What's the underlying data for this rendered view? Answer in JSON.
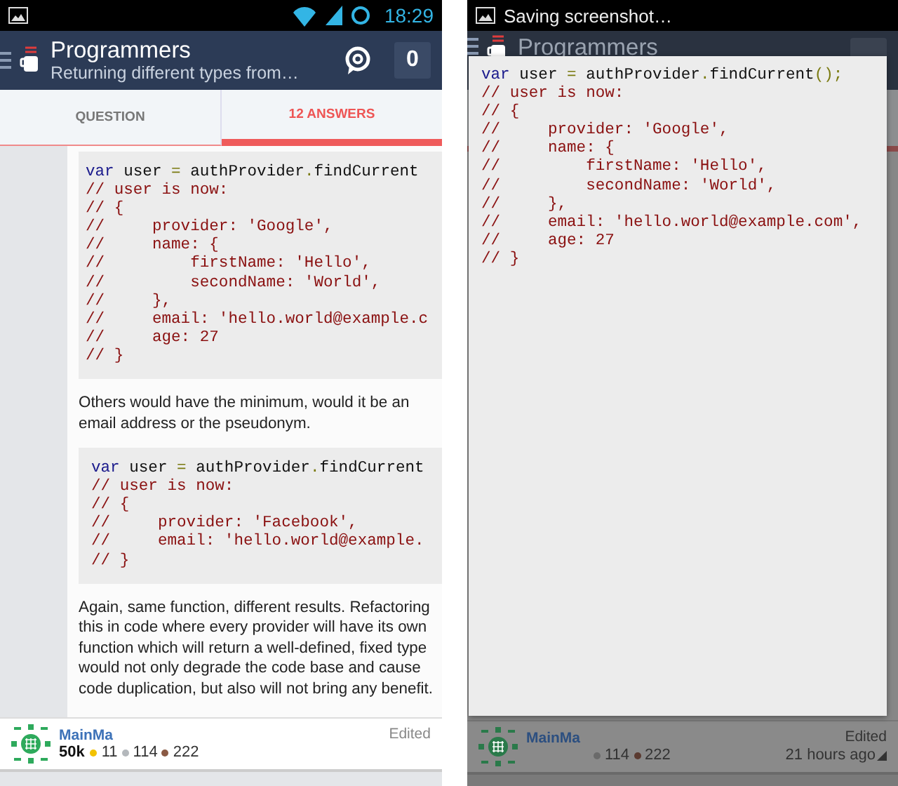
{
  "left_screen": {
    "status_bar": {
      "time": "18:29"
    },
    "header": {
      "title": "Programmers",
      "subtitle": "Returning different types from…",
      "count": "0"
    },
    "tabs": [
      {
        "label": "QUESTION",
        "selected": false
      },
      {
        "label": "12 ANSWERS",
        "selected": true
      }
    ],
    "answer": [
      {
        "kind": "code",
        "lines": [
          [
            {
              "kind": "keyword",
              "text": "var"
            },
            {
              "kind": "plain",
              "text": " user "
            },
            {
              "kind": "punct",
              "text": "="
            },
            {
              "kind": "plain",
              "text": " authProvider"
            },
            {
              "kind": "punct",
              "text": "."
            },
            {
              "kind": "plain",
              "text": "findCurrent"
            }
          ],
          [
            {
              "kind": "comment",
              "text": "// user is now:"
            }
          ],
          [
            {
              "kind": "comment",
              "text": "// {"
            }
          ],
          [
            {
              "kind": "comment",
              "text": "//     provider: 'Google',"
            }
          ],
          [
            {
              "kind": "comment",
              "text": "//     name: {"
            }
          ],
          [
            {
              "kind": "comment",
              "text": "//         firstName: 'Hello',"
            }
          ],
          [
            {
              "kind": "comment",
              "text": "//         secondName: 'World',"
            }
          ],
          [
            {
              "kind": "comment",
              "text": "//     },"
            }
          ],
          [
            {
              "kind": "comment",
              "text": "//     email: 'hello.world@example.c"
            }
          ],
          [
            {
              "kind": "comment",
              "text": "//     age: 27"
            }
          ],
          [
            {
              "kind": "comment",
              "text": "// }"
            }
          ]
        ]
      },
      {
        "kind": "text",
        "text": "Others would have the minimum, would it be an email address or the pseudonym."
      },
      {
        "kind": "code",
        "lines": [
          [
            {
              "kind": "keyword",
              "text": "var"
            },
            {
              "kind": "plain",
              "text": " user "
            },
            {
              "kind": "punct",
              "text": "="
            },
            {
              "kind": "plain",
              "text": " authProvider"
            },
            {
              "kind": "punct",
              "text": "."
            },
            {
              "kind": "plain",
              "text": "findCurrent"
            }
          ],
          [
            {
              "kind": "comment",
              "text": "// user is now:"
            }
          ],
          [
            {
              "kind": "comment",
              "text": "// {"
            }
          ],
          [
            {
              "kind": "comment",
              "text": "//     provider: 'Facebook',"
            }
          ],
          [
            {
              "kind": "comment",
              "text": "//     email: 'hello.world@example."
            }
          ],
          [
            {
              "kind": "comment",
              "text": "// }"
            }
          ]
        ]
      },
      {
        "kind": "text",
        "text": "Again, same function, different results. Refactoring this in code where every provider will have its own function which will return a well-defined, fixed type would not only degrade the code base and cause code duplication, but also will not bring any benefit."
      }
    ],
    "author": {
      "name": "MainMa",
      "reputation": "50k",
      "badges": [
        {
          "color": "#f2c200",
          "count": "11"
        },
        {
          "color": "#b4b8bc",
          "count": "114"
        },
        {
          "color": "#8a5a44",
          "count": "222"
        }
      ],
      "edited": "Edited"
    }
  },
  "right_screen": {
    "status_bar": {
      "notification": "Saving screenshot…"
    },
    "header": {
      "title": "Programmers"
    },
    "code_preview": {
      "lines": [
        [
          {
            "kind": "keyword",
            "text": "var"
          },
          {
            "kind": "plain",
            "text": " user "
          },
          {
            "kind": "punct",
            "text": "="
          },
          {
            "kind": "plain",
            "text": " authProvider"
          },
          {
            "kind": "punct",
            "text": "."
          },
          {
            "kind": "plain",
            "text": "findCurrent"
          },
          {
            "kind": "punct",
            "text": "();"
          }
        ],
        [
          {
            "kind": "comment",
            "text": "// user is now:"
          }
        ],
        [
          {
            "kind": "comment",
            "text": "// {"
          }
        ],
        [
          {
            "kind": "comment",
            "text": "//     provider: 'Google',"
          }
        ],
        [
          {
            "kind": "comment",
            "text": "//     name: {"
          }
        ],
        [
          {
            "kind": "comment",
            "text": "//         firstName: 'Hello',"
          }
        ],
        [
          {
            "kind": "comment",
            "text": "//         secondName: 'World',"
          }
        ],
        [
          {
            "kind": "comment",
            "text": "//     },"
          }
        ],
        [
          {
            "kind": "comment",
            "text": "//     email: 'hello.world@example.com',"
          }
        ],
        [
          {
            "kind": "comment",
            "text": "//     age: 27"
          }
        ],
        [
          {
            "kind": "comment",
            "text": "// }"
          }
        ]
      ]
    },
    "author": {
      "name": "MainMa",
      "badges": [
        {
          "color": "#6a6a6a",
          "count": "114"
        },
        {
          "color": "#5a3a30",
          "count": "222"
        }
      ],
      "edited": "Edited",
      "time": "21 hours ago"
    }
  }
}
